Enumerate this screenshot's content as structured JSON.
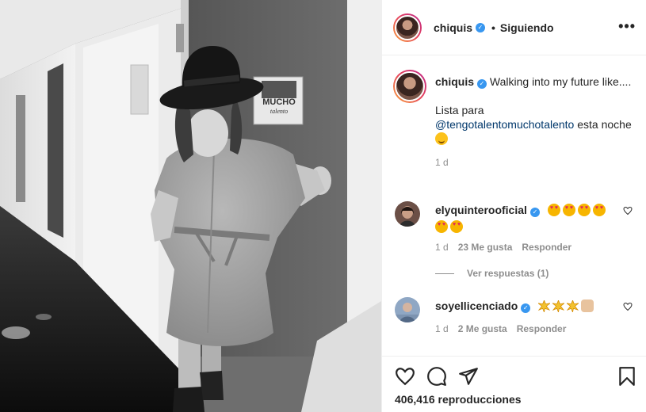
{
  "post": {
    "username": "chiquis",
    "separator": "•",
    "follow_status": "Siguiendo",
    "more_label": "•••"
  },
  "caption": {
    "username": "chiquis",
    "line1": "Walking into my future like....",
    "line2": "Lista para",
    "mention": "@tengotalentomuchotalento",
    "line3_suffix": "esta noche",
    "time": "1 d"
  },
  "comments": [
    {
      "username": "elyquinterooficial",
      "time": "1 d",
      "likes": "23 Me gusta",
      "reply_label": "Responder",
      "view_replies": "Ver respuestas (1)"
    },
    {
      "username": "soyellicenciado",
      "time": "1 d",
      "likes": "2 Me gusta",
      "reply_label": "Responder"
    }
  ],
  "door_sign": {
    "line1": "MUCHO",
    "line2": "talento"
  },
  "stats": {
    "views": "406,416 reproducciones"
  },
  "colors": {
    "verified": "#3897f0",
    "mention": "#00376b",
    "meta": "#8e8e8e",
    "border": "#efefef"
  },
  "icons": [
    "ellipsis-icon",
    "heart-icon",
    "comment-icon",
    "share-icon",
    "bookmark-icon",
    "verified-badge-icon"
  ]
}
